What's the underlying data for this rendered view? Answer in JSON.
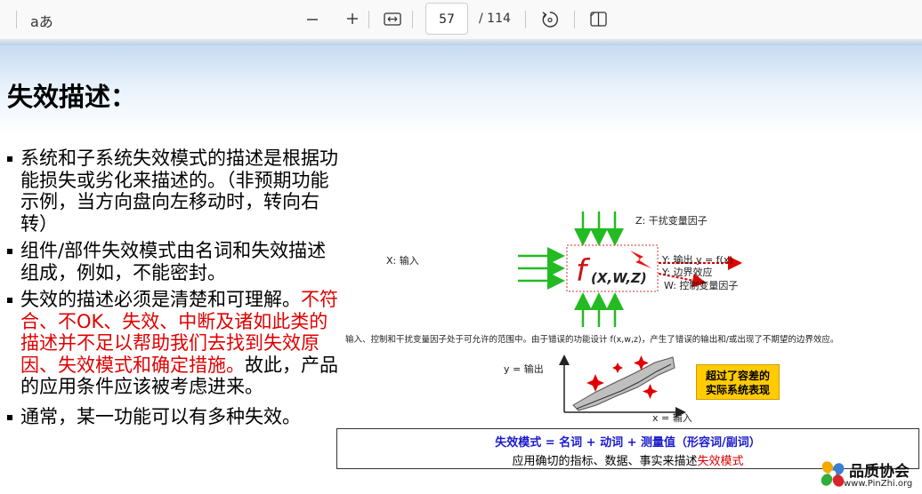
{
  "toolbar": {
    "read_aloud_label": "aあ",
    "page_number": "57",
    "page_total": "/ 114"
  },
  "slide": {
    "title": "失效描述：",
    "bullets": [
      {
        "text": "系统和子系统失效模式的描述是根据功能损失或劣化来描述的。（非预期功能示例，当方向盘向左移动时，转向右转）",
        "red": "",
        "after": ""
      },
      {
        "text": "组件/部件失效模式由名词和失效描述组成，例如，不能密封。",
        "red": "",
        "after": ""
      },
      {
        "text": "失效的描述必须是清楚和可理解。",
        "red": "不符合、不OK、失效、中断及诸如此类的描述并不足以帮助我们去找到失效原因、失效模式和确定措施。",
        "after": "故此，产品的应用条件应该被考虑进来。"
      },
      {
        "text": "通常，某一功能可以有多种失效。",
        "red": "",
        "after": ""
      }
    ]
  },
  "figure": {
    "z_label": "Z: 干扰变量因子",
    "x_label": "X: 输入",
    "func_label": "f",
    "func_args": "(X,W,Z)",
    "y_label": "Y: 输出 y = f(x)",
    "y2_label": "Y: 边界效应",
    "w_label": "W: 控制变量因子",
    "caption": "输入、控制和干扰变量因子处于可允许的范围中。由于错误的功能设计 f(x,w,z)，产生了错误的输出和/或出现了不期望的边界效应。",
    "graph_y_label": "y = 输出",
    "graph_x_label": "x = 输入",
    "callout_line1": "超过了容差的",
    "callout_line2": "实际系统表现"
  },
  "bottom_box": {
    "line1": "失效模式 = 名词 + 动词 + 测量值（形容词/副词）",
    "line2_prefix": "应用确切的指标、数据、事实来描述",
    "line2_red": "失效模式"
  },
  "watermark": {
    "name": "品质协会",
    "url": "www.PinZhi.org"
  },
  "colors": {
    "red_text": "#e00000",
    "arrow_green": "#22bb22",
    "callout_yellow": "#ffcc00",
    "formula_blue": "#1a1acc"
  }
}
